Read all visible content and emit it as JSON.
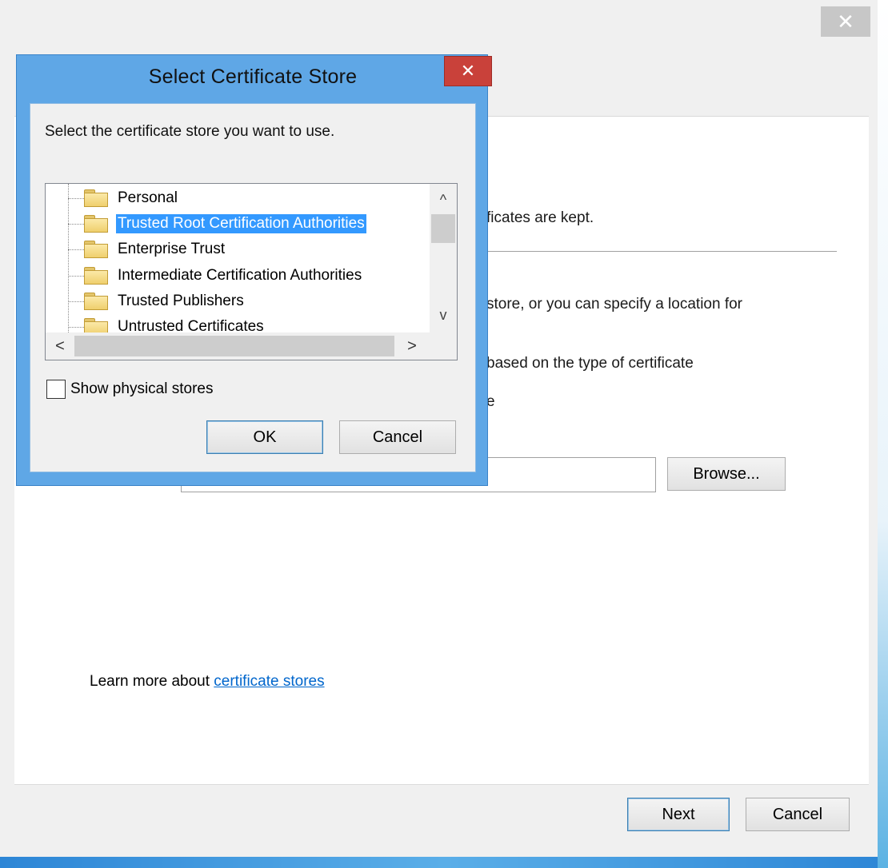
{
  "wizard": {
    "close_glyph": "✕",
    "text_kept": "ficates are kept.",
    "text_store": "store, or you can specify a location for",
    "text_based": "based on the type of certificate",
    "text_partial": "e",
    "browse_label": "Browse...",
    "learn_prefix": "Learn more about ",
    "learn_link": "certificate stores",
    "next_label": "Next",
    "cancel_label": "Cancel"
  },
  "dialog": {
    "title": "Select Certificate Store",
    "close_glyph": "✕",
    "prompt": "Select the certificate store you want to use.",
    "stores": [
      {
        "label": "Personal",
        "selected": false
      },
      {
        "label": "Trusted Root Certification Authorities",
        "selected": true
      },
      {
        "label": "Enterprise Trust",
        "selected": false
      },
      {
        "label": "Intermediate Certification Authorities",
        "selected": false
      },
      {
        "label": "Trusted Publishers",
        "selected": false
      },
      {
        "label": "Untrusted Certificates",
        "selected": false
      }
    ],
    "scroll_up": "^",
    "scroll_down": "v",
    "scroll_left": "<",
    "scroll_right": ">",
    "show_physical_label": "Show physical stores",
    "show_physical_checked": false,
    "ok_label": "OK",
    "cancel_label": "Cancel"
  },
  "colors": {
    "dialog_frame": "#5fa7e6",
    "selection": "#3399ff",
    "close_red": "#c9413a",
    "link": "#0066cc"
  }
}
